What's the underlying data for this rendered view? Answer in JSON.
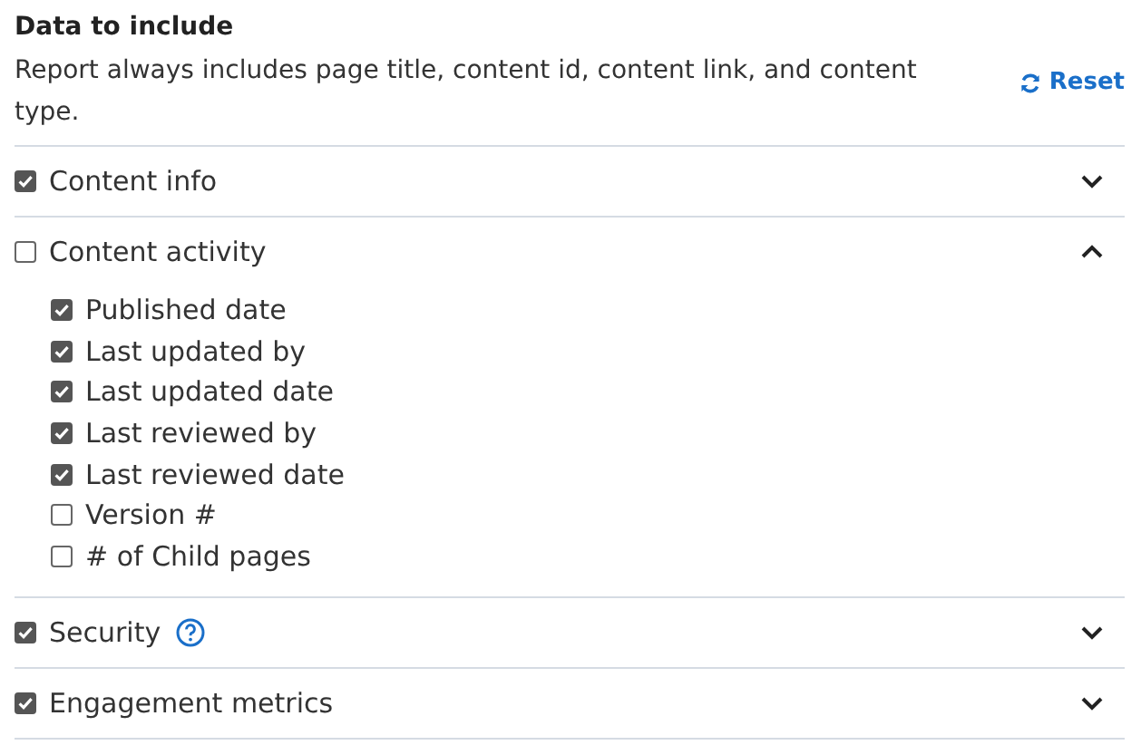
{
  "heading": "Data to include",
  "description": "Report always includes page title, content id, content link, and content type.",
  "reset_button": {
    "label": "Reset"
  },
  "sections": [
    {
      "label": "Content info",
      "checked": true,
      "expanded": false,
      "help": false
    },
    {
      "label": "Content activity",
      "checked": false,
      "expanded": true,
      "help": false,
      "children": [
        {
          "label": "Published date",
          "checked": true
        },
        {
          "label": "Last updated by",
          "checked": true
        },
        {
          "label": "Last updated date",
          "checked": true
        },
        {
          "label": "Last reviewed by",
          "checked": true
        },
        {
          "label": "Last reviewed date",
          "checked": true
        },
        {
          "label": "Version #",
          "checked": false
        },
        {
          "label": "# of Child pages",
          "checked": false
        }
      ]
    },
    {
      "label": "Security",
      "checked": true,
      "expanded": false,
      "help": true
    },
    {
      "label": "Engagement metrics",
      "checked": true,
      "expanded": false,
      "help": false
    }
  ]
}
